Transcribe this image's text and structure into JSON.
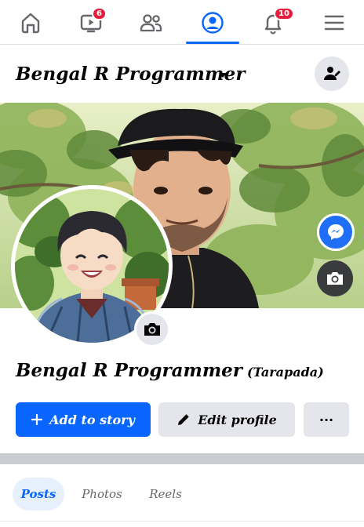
{
  "nav": {
    "items": [
      {
        "icon": "home-icon"
      },
      {
        "icon": "video-icon",
        "badge": "6"
      },
      {
        "icon": "friends-icon"
      },
      {
        "icon": "profile-icon",
        "active": true
      },
      {
        "icon": "bell-icon",
        "badge": "10"
      },
      {
        "icon": "menu-icon"
      }
    ]
  },
  "header": {
    "page_name": "Bengal R Programmer",
    "switch_icon": "switch-profile-icon"
  },
  "profile": {
    "name": "Bengal R Programmer",
    "nickname": "(Tarapada)"
  },
  "actions": {
    "add_story": "Add to story",
    "edit_profile": "Edit profile",
    "more": "···"
  },
  "tabs": [
    {
      "label": "Posts",
      "active": true
    },
    {
      "label": "Photos"
    },
    {
      "label": "Reels"
    }
  ],
  "colors": {
    "accent": "#0866ff",
    "badge": "#e41e3f",
    "button_gray": "#e4e6eb"
  }
}
